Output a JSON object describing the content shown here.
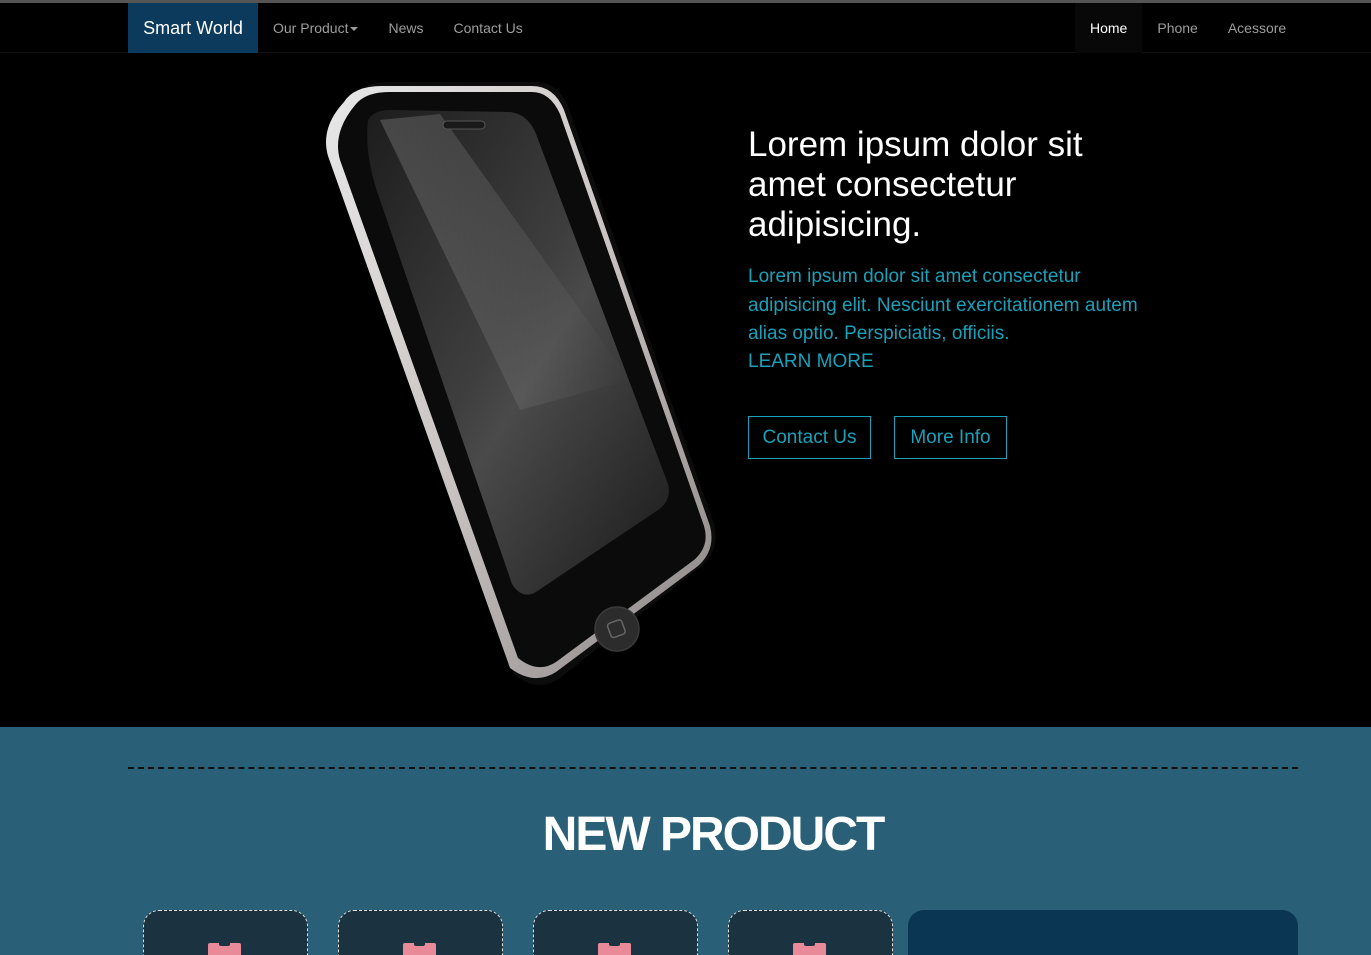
{
  "nav": {
    "brand": "Smart World",
    "left_items": [
      {
        "label": "Our Product"
      },
      {
        "label": "News"
      },
      {
        "label": "Contact Us"
      }
    ],
    "right_items": [
      {
        "label": "Home"
      },
      {
        "label": "Phone"
      },
      {
        "label": "Acessore"
      }
    ]
  },
  "hero": {
    "title": "Lorem ipsum dolor sit amet consectetur adipisicing.",
    "text": "Lorem ipsum dolor sit amet consectetur adipisicing elit. Nesciunt exercitationem autem alias optio. Perspiciatis, officiis.",
    "learn_more": "LEARN MORE",
    "buttons": {
      "contact": "Contact Us",
      "more_info": "More Info"
    }
  },
  "products": {
    "title": "NEW PRODUCT"
  },
  "colors": {
    "brand_bg": "#0b3a5c",
    "accent": "#1aa0b8",
    "section_bg": "#2a6077",
    "card_bg": "#1b3340",
    "tag": "#e88a97"
  }
}
